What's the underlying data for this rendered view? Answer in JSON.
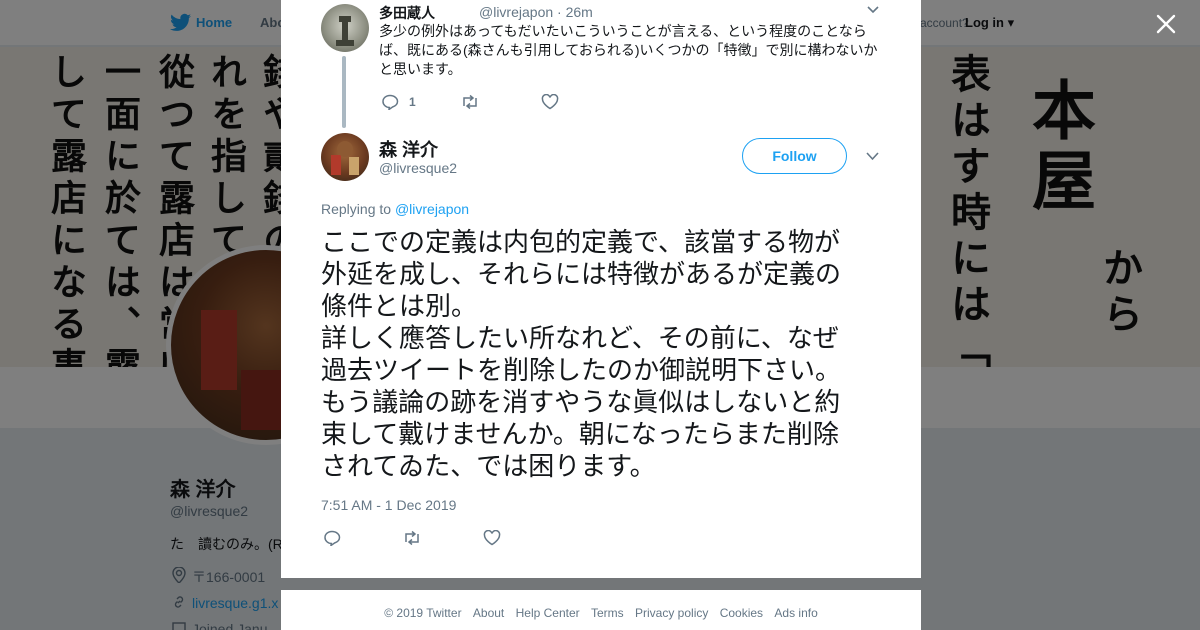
{
  "nav": {
    "home": "Home",
    "about": "Abo",
    "account_text": "account?",
    "login": "Log in"
  },
  "banner_columns": [
    "本屋",
    "表はす時には「書肆",
    "から",
    "して露店になる事も",
    "一面に於ては、露店",
    "從つて露店は常店",
    "れを指して露",
    "錢や貳錢の"
  ],
  "profile": {
    "name": "森 洋介",
    "handle": "@livresque2",
    "bio": "た　讀むのみ。(R",
    "location": "〒166-0001",
    "website": "livresque.g1.x",
    "joined": "Joined Janu"
  },
  "reply": {
    "name": "多田蔵人",
    "handle_time": "@livrejapon · 26m",
    "text": "多少の例外はあってもだいたいこういうことが言える、という程度のことならば、既にある(森さんも引用しておられる)いくつかの「特徴」で別に構わないかと思います。",
    "reply_count": "1"
  },
  "tweet": {
    "name": "森 洋介",
    "handle": "@livresque2",
    "follow_label": "Follow",
    "replying_prefix": "Replying to",
    "replying_to": "@livrejapon",
    "text": "ここでの定義は内包的定義で、該當する物が外延を成し、それらには特徴があるが定義の條件とは別。\n詳しく應答したい所なれど、その前に、なぜ過去ツイートを削除したのか御説明下さい。\nもう議論の跡を消すやうな眞似はしないと約束して戴けませんか。朝になったらまた削除されてゐた、では困ります。",
    "timestamp": "7:51 AM - 1 Dec 2019"
  },
  "footer": {
    "links": [
      "© 2019 Twitter",
      "About",
      "Help Center",
      "Terms",
      "Privacy policy",
      "Cookies",
      "Ads info"
    ]
  },
  "colors": {
    "accent": "#1da1f2",
    "muted": "#657786",
    "overlay": "rgba(0,0,0,0.5)"
  },
  "icons": [
    "twitter-bird-icon",
    "close-icon",
    "chevron-down-icon",
    "reply-icon",
    "retweet-icon",
    "like-icon",
    "location-icon",
    "link-icon",
    "calendar-icon"
  ]
}
